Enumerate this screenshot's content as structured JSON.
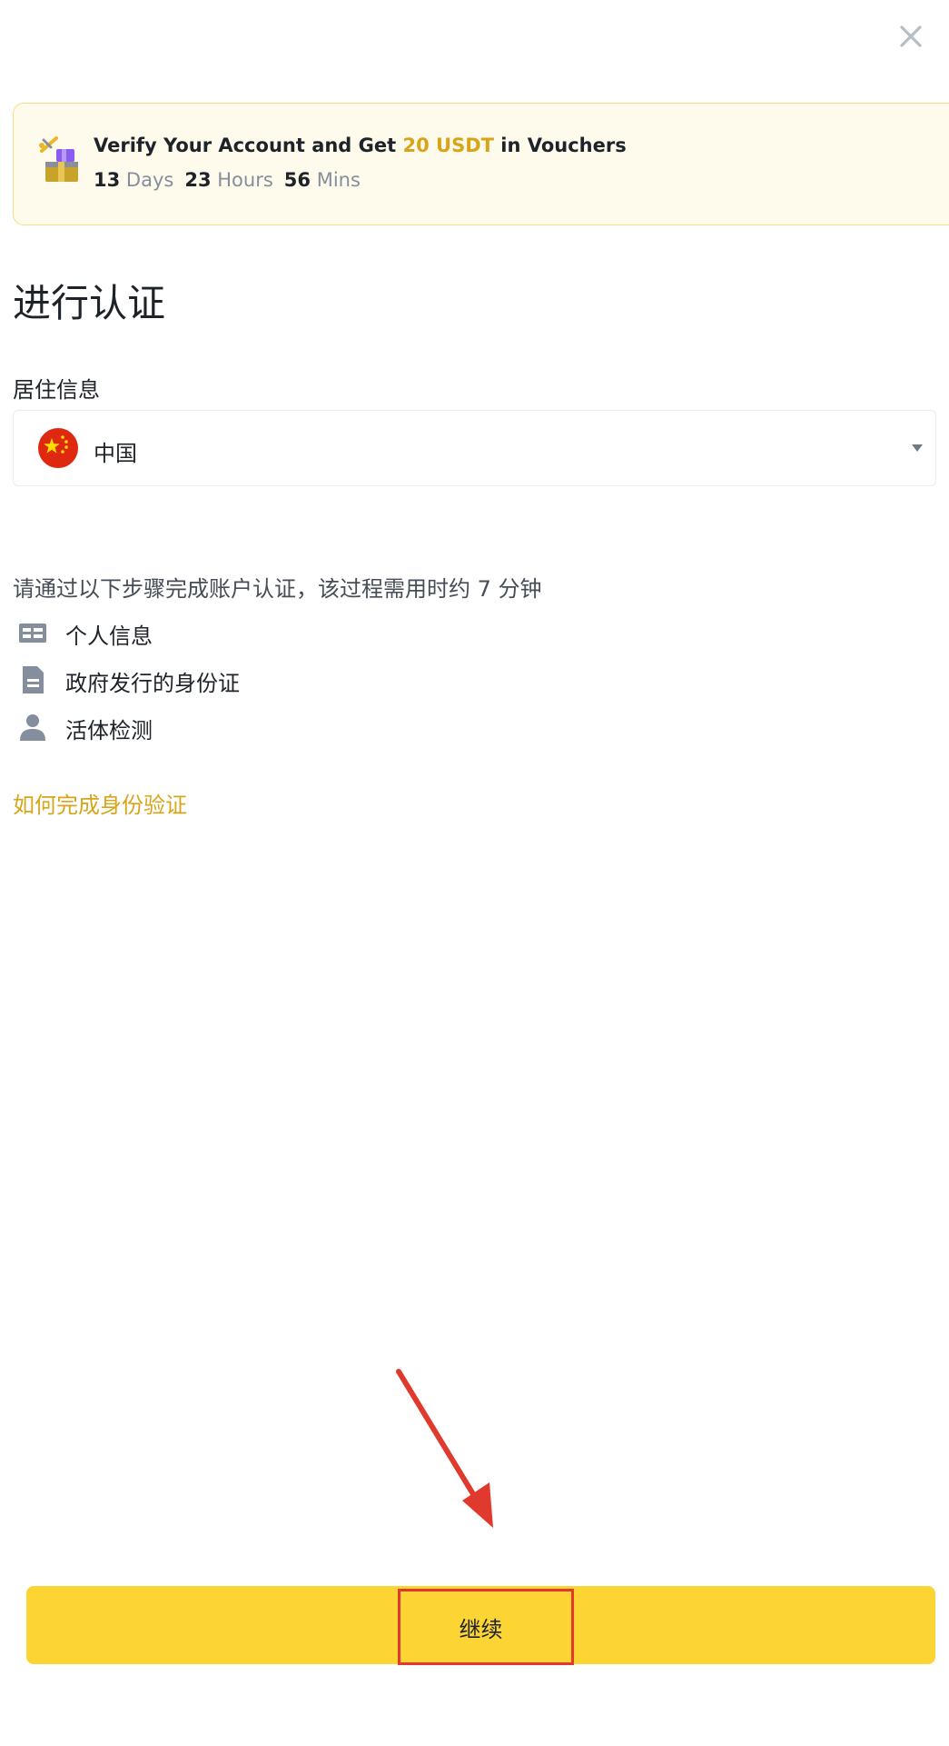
{
  "header": {
    "close_icon": "close-icon"
  },
  "banner": {
    "gift_icon": "gift-voucher-icon",
    "text_before": "Verify Your Account and Get ",
    "amount": "20 USDT",
    "text_after": " in Vouchers",
    "countdown": {
      "days_value": "13",
      "days_label": "Days",
      "hours_value": "23",
      "hours_label": "Hours",
      "mins_value": "56",
      "mins_label": "Mins"
    },
    "colors": {
      "background": "#fffbec",
      "border": "#f6e08a",
      "accent": "#d8a418"
    }
  },
  "page": {
    "title": "进行认证"
  },
  "residence": {
    "label": "居住信息",
    "selected_country": "中国",
    "flag_icon": "china-flag-icon",
    "dropdown_icon": "caret-down-icon"
  },
  "steps": {
    "intro": "请通过以下步骤完成账户认证，该过程需用时约 7 分钟",
    "items": [
      {
        "icon": "id-card-icon",
        "label": "个人信息"
      },
      {
        "icon": "document-icon",
        "label": "政府发行的身份证"
      },
      {
        "icon": "person-icon",
        "label": "活体检测"
      }
    ]
  },
  "help_link": "如何完成身份验证",
  "annotation": {
    "arrow_icon": "red-arrow-icon",
    "color": "#e03a2f"
  },
  "footer": {
    "continue_label": "继续",
    "button_color": "#fcd535"
  }
}
